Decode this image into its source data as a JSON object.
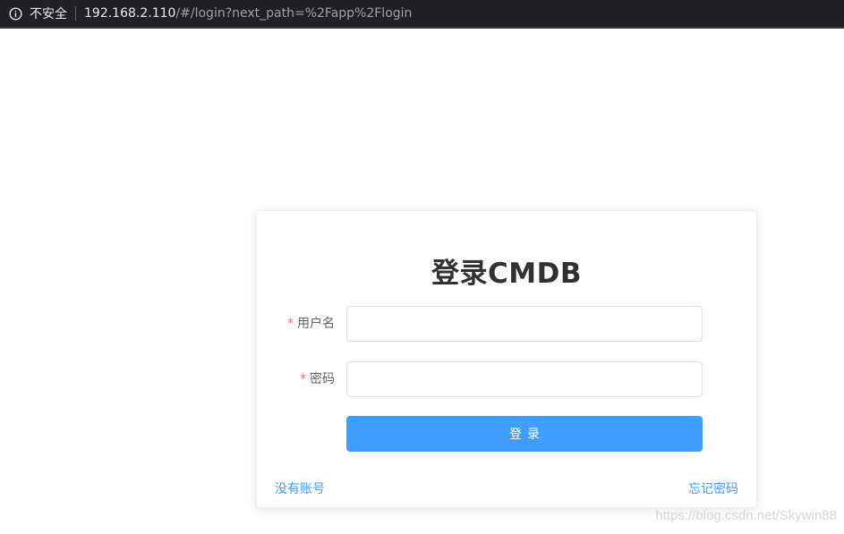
{
  "browser": {
    "security_label": "不安全",
    "url_host": "192.168.2.110",
    "url_path": "/#/login?next_path=%2Fapp%2Flogin",
    "info_icon": "info-icon"
  },
  "login": {
    "title": "登录CMDB",
    "username_label": "用户名",
    "password_label": "密码",
    "required_mark": "*",
    "username_value": "",
    "password_value": "",
    "submit_label": "登录",
    "register_link": "没有账号",
    "forgot_link": "忘记密码"
  },
  "watermark": "https://blog.csdn.net/Skywin88",
  "colors": {
    "primary": "#409eff",
    "required": "#f56c6c",
    "title": "#303133"
  }
}
